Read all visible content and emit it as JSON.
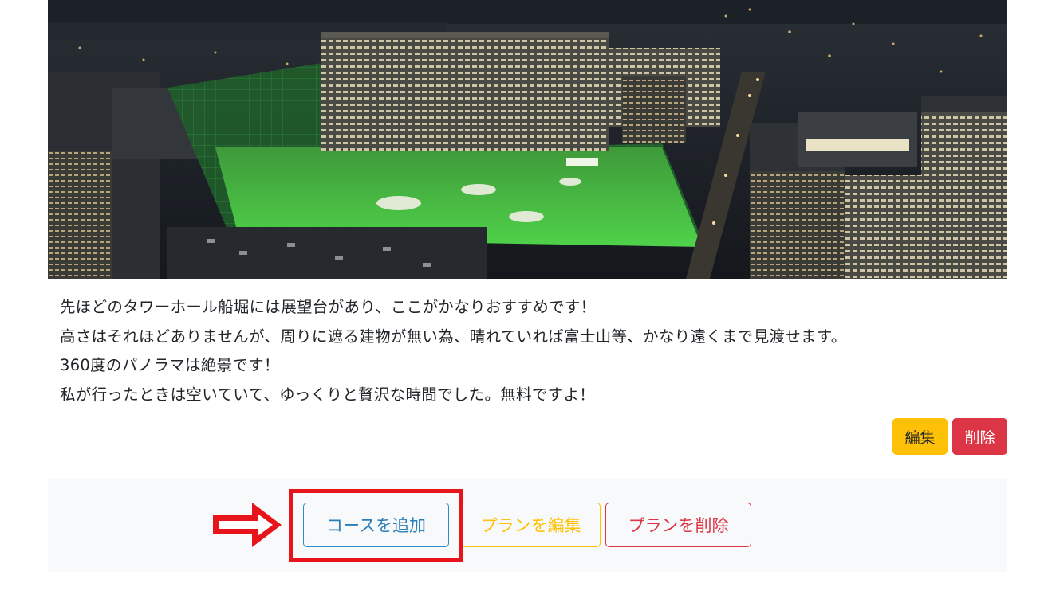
{
  "post": {
    "lines": [
      "先ほどのタワーホール船堀には展望台があり、ここがかなりおすすめです！",
      "高さはそれほどありませんが、周りに遮る建物が無い為、晴れていれば富士山等、かなり遠くまで見渡せます。",
      "360度のパノラマは絶景です！",
      "私が行ったときは空いていて、ゆっくりと贅沢な時間でした。無料ですよ！"
    ],
    "edit_label": "編集",
    "delete_label": "削除"
  },
  "plan": {
    "add_course_label": "コースを追加",
    "edit_plan_label": "プランを編集",
    "delete_plan_label": "プランを削除"
  },
  "colors": {
    "warning": "#ffc107",
    "danger": "#dc3545",
    "info": "#2b8ec6",
    "highlight": "#e8141c",
    "plan_bar_bg": "#f8f9fa"
  },
  "icons": {
    "annotation_arrow": "right-arrow-icon"
  }
}
